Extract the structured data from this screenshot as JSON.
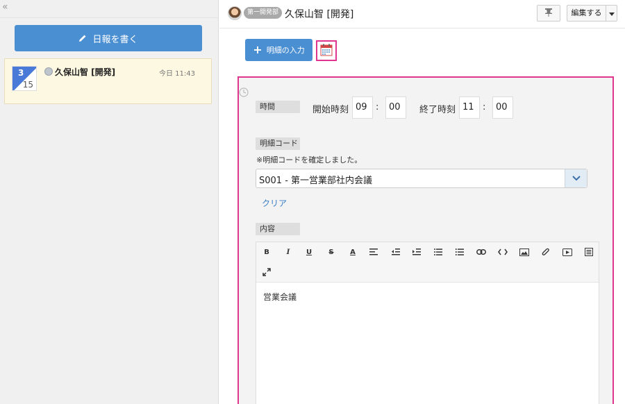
{
  "sidebar": {
    "collapse_glyph": "«",
    "write_button": "日報を書く",
    "entry": {
      "month": "3",
      "day": "15",
      "author": "久保山智 [開発]",
      "time": "今日 11:43"
    }
  },
  "header": {
    "dept_badge": "第一開発部",
    "author": "久保山智 [開発]",
    "edit_label": "編集する"
  },
  "toolbar": {
    "add_detail": "明細の入力"
  },
  "form": {
    "time_label": "時間",
    "start_label": "開始時刻",
    "start_hour": "09",
    "start_min": "00",
    "end_label": "終了時刻",
    "end_hour": "11",
    "end_min": "00",
    "colon": ":",
    "code_label": "明細コード",
    "code_note": "※明細コードを確定しました。",
    "code_value": "S001 - 第一営業部社内会議",
    "clear": "クリア",
    "content_label": "内容",
    "content_text": "営業会議"
  },
  "editor_tools": {
    "bold": "B",
    "italic": "I",
    "underline": "U",
    "strike": "S",
    "color": "A"
  },
  "colors": {
    "primary": "#4b8fd3",
    "highlight": "#e0358f",
    "entry_bg": "#fdf8e1"
  }
}
